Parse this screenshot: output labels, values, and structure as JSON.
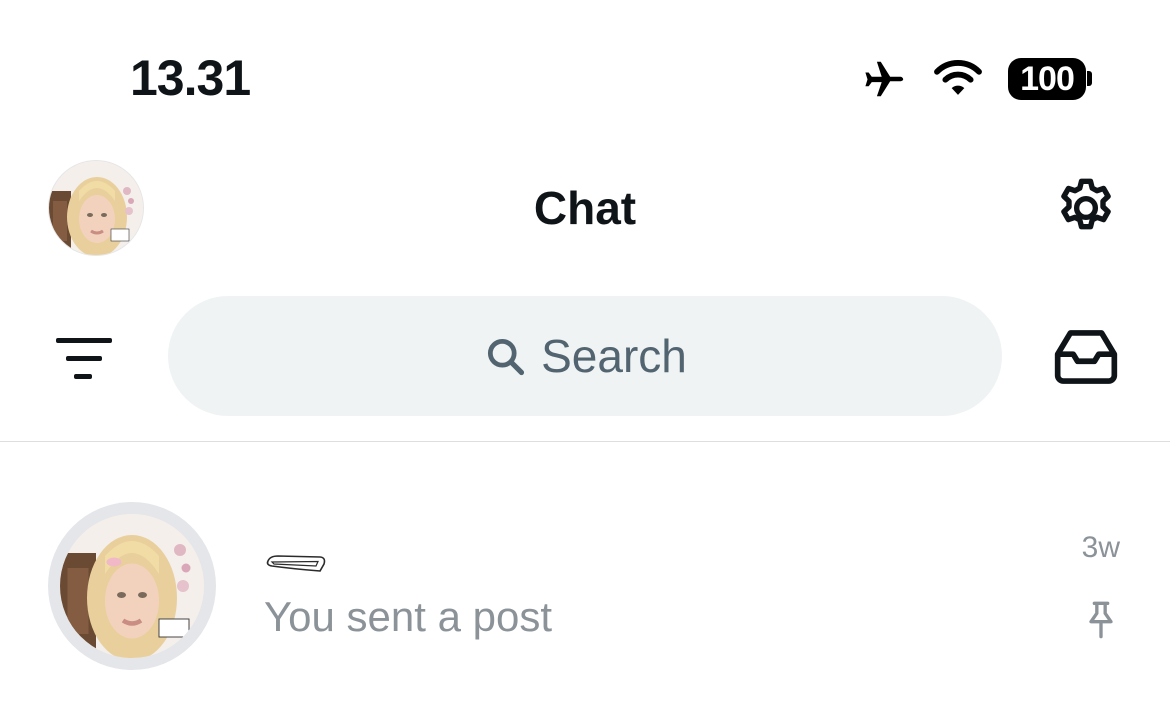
{
  "status_bar": {
    "time": "13.31",
    "battery_level": "100",
    "icons": [
      "airplane-icon",
      "wifi-icon",
      "battery-icon"
    ]
  },
  "header": {
    "title": "Chat",
    "avatar_caption": "\"MUSE?\nHAUTE\"",
    "icons": [
      "profile-avatar",
      "gear-icon"
    ]
  },
  "search": {
    "placeholder": "Search",
    "icons": [
      "filter-icon",
      "search-icon",
      "inbox-icon"
    ]
  },
  "conversations": [
    {
      "name_icon": "hairclip-icon",
      "preview": "You sent a post",
      "time": "3w",
      "pinned": true,
      "avatar_caption": "\"MUSE?\nHAUTE\""
    }
  ],
  "colors": {
    "text_primary": "#0f1419",
    "text_secondary": "#536471",
    "text_muted": "#8b9399",
    "search_bg": "#eff3f4",
    "divider": "#dcdfe2"
  }
}
